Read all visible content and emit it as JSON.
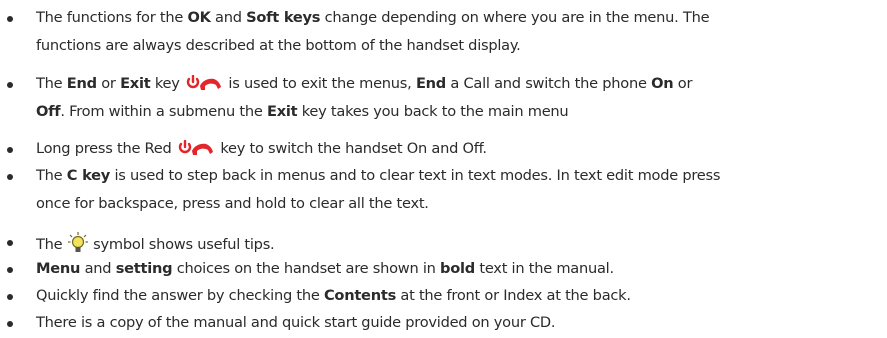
{
  "bullets": [
    {
      "lines": [
        [
          {
            "t": "The functions for the "
          },
          {
            "t": "OK",
            "b": true
          },
          {
            "t": " and "
          },
          {
            "t": "Soft keys",
            "b": true
          },
          {
            "t": " change depending on where you are in the menu. The"
          }
        ],
        [
          {
            "t": "functions are always described at the bottom of the handset display."
          }
        ]
      ]
    },
    {
      "lines": [
        [
          {
            "t": "The "
          },
          {
            "t": "End",
            "b": true
          },
          {
            "t": " or "
          },
          {
            "t": "Exit",
            "b": true
          },
          {
            "t": " key "
          },
          {
            "icon": "end-key-icon"
          },
          {
            "t": " is used to exit the menus, "
          },
          {
            "t": "End",
            "b": true
          },
          {
            "t": " a Call and switch the phone "
          },
          {
            "t": "On",
            "b": true
          },
          {
            "t": " or"
          }
        ],
        [
          {
            "t": "Off",
            "b": true
          },
          {
            "t": ". From within a submenu the "
          },
          {
            "t": "Exit",
            "b": true
          },
          {
            "t": " key takes you back to the main menu"
          }
        ]
      ]
    },
    {
      "lines": [
        [
          {
            "t": "Long press the Red "
          },
          {
            "icon": "end-key-icon"
          },
          {
            "t": " key to switch the handset On and Off."
          }
        ]
      ]
    },
    {
      "lines": [
        [
          {
            "t": "The "
          },
          {
            "t": "C key",
            "b": true
          },
          {
            "t": " is used to step back in menus and to clear text in text modes. In text edit mode press"
          }
        ],
        [
          {
            "t": "once for backspace, press and hold to clear all the text."
          }
        ]
      ]
    },
    {
      "lines": [
        [
          {
            "t": "The "
          },
          {
            "icon": "tip-lightbulb-icon"
          },
          {
            "t": " symbol shows useful tips."
          }
        ]
      ]
    },
    {
      "lines": [
        [
          {
            "t": "Menu",
            "b": true
          },
          {
            "t": " and "
          },
          {
            "t": "setting",
            "b": true
          },
          {
            "t": " choices on the handset are shown in "
          },
          {
            "t": "bold",
            "b": true
          },
          {
            "t": " text in the manual."
          }
        ]
      ]
    },
    {
      "lines": [
        [
          {
            "t": "Quickly find the answer by checking the "
          },
          {
            "t": "Contents",
            "b": true
          },
          {
            "t": " at the front or Index at the back."
          }
        ]
      ]
    },
    {
      "lines": [
        [
          {
            "t": "There is a copy of the manual and quick start guide provided on your CD."
          }
        ]
      ]
    }
  ],
  "colors": {
    "text": "#2b2b2b",
    "end_key_red": "#e3262b",
    "tip_bulb_yellow": "#f2e35a",
    "tip_bulb_outline": "#6d6d2a"
  }
}
